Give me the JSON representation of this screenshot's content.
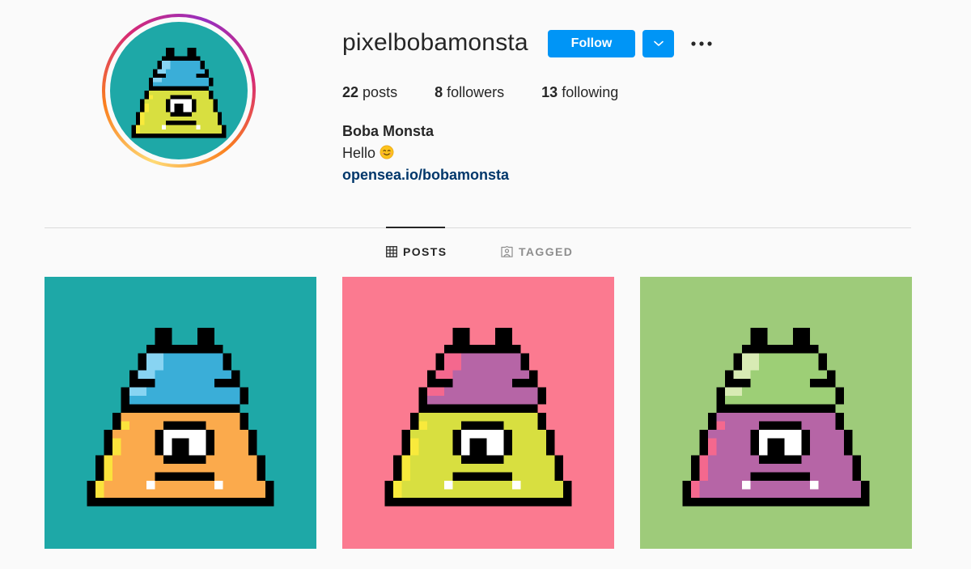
{
  "profile": {
    "username": "pixelbobamonsta",
    "full_name": "Boba Monsta",
    "bio": "Hello",
    "bio_emoji": "smiling-face-icon",
    "link": "opensea.io/bobamonsta",
    "avatar_bg": "#1ea8a7"
  },
  "actions": {
    "follow_label": "Follow",
    "dropdown_icon": "chevron-down-icon",
    "more_icon": "ellipsis-icon",
    "accent": "#0095f6"
  },
  "stats": {
    "posts_count": "22",
    "posts_label": "posts",
    "followers_count": "8",
    "followers_label": "followers",
    "following_count": "13",
    "following_label": "following"
  },
  "tabs": [
    {
      "label": "POSTS",
      "icon": "grid-icon",
      "active": true
    },
    {
      "label": "TAGGED",
      "icon": "tagged-icon",
      "active": false
    }
  ],
  "posts": [
    {
      "bg": "#1ea8a7",
      "hat": "#3aaed8",
      "hat_light": "#88d4f2",
      "body": "#fbaa4c",
      "body_light": "#fbe33c"
    },
    {
      "bg": "#fb7a90",
      "hat": "#b665a6",
      "hat_light": "#f4688e",
      "body": "#d8df40",
      "body_light": "#f8ea3c"
    },
    {
      "bg": "#9ecb7a",
      "hat": "#9dcf76",
      "hat_light": "#d8ebb4",
      "body": "#b665a6",
      "body_light": "#f4688e"
    }
  ]
}
